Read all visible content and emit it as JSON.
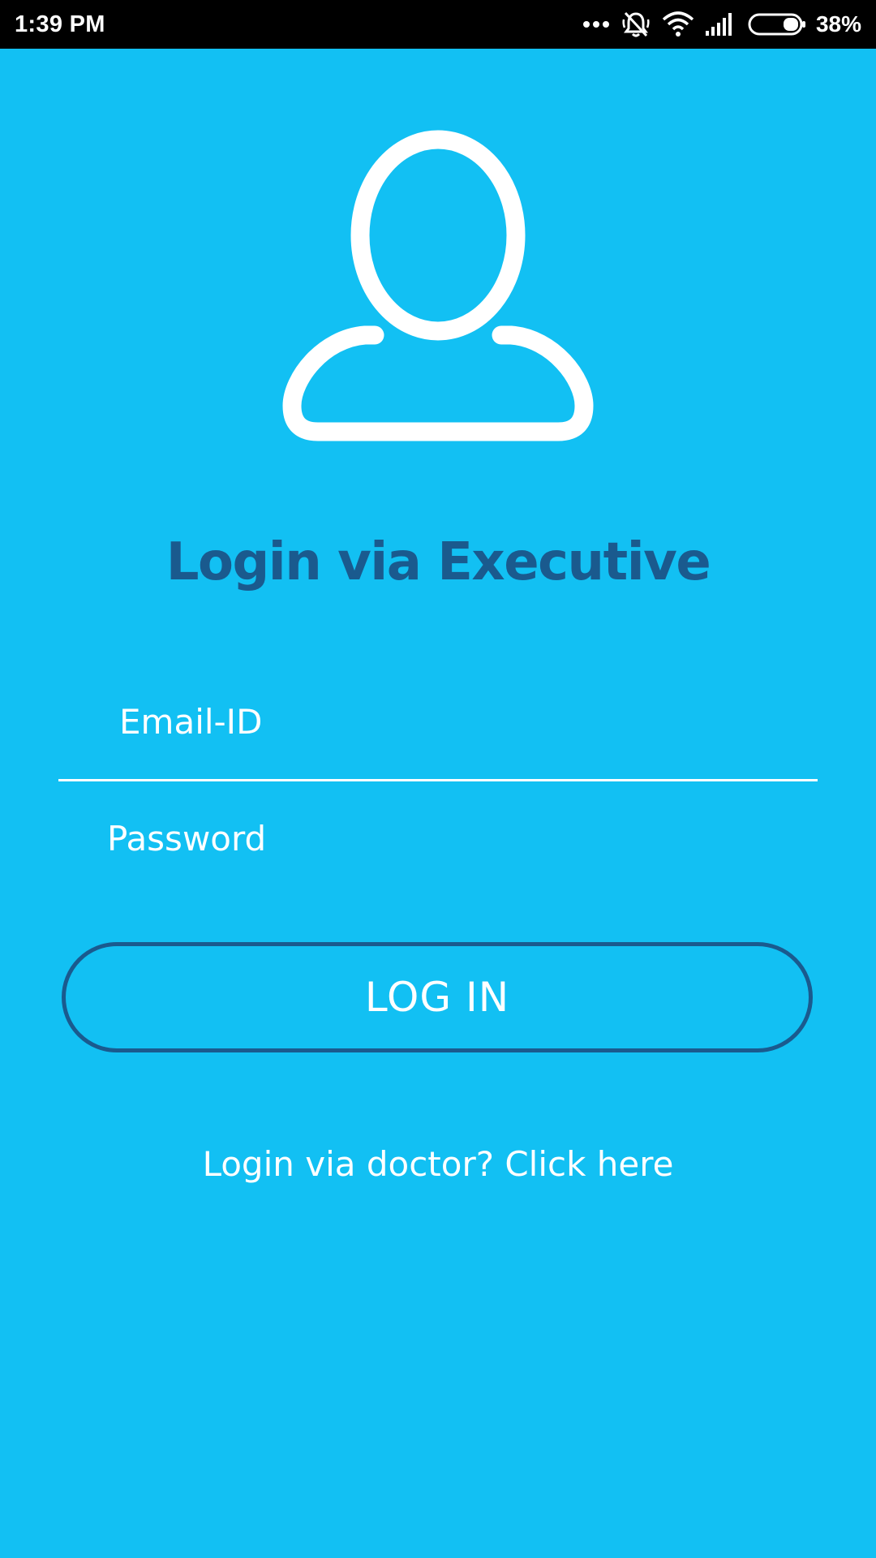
{
  "status_bar": {
    "time": "1:39 PM",
    "battery_percent": "38%",
    "icons": [
      "more-dots-icon",
      "silent-bell-icon",
      "wifi-icon",
      "signal-icon",
      "battery-icon"
    ]
  },
  "avatar": {
    "icon": "user-icon"
  },
  "login": {
    "title": "Login via Executive",
    "email_placeholder": "Email-ID",
    "password_placeholder": "Password",
    "button_label": "LOG IN",
    "doctor_link": "Login via doctor? Click here"
  },
  "colors": {
    "background": "#12c0f3",
    "accent_dark": "#1a5a8e",
    "text": "#ffffff",
    "status_bar": "#000000"
  }
}
